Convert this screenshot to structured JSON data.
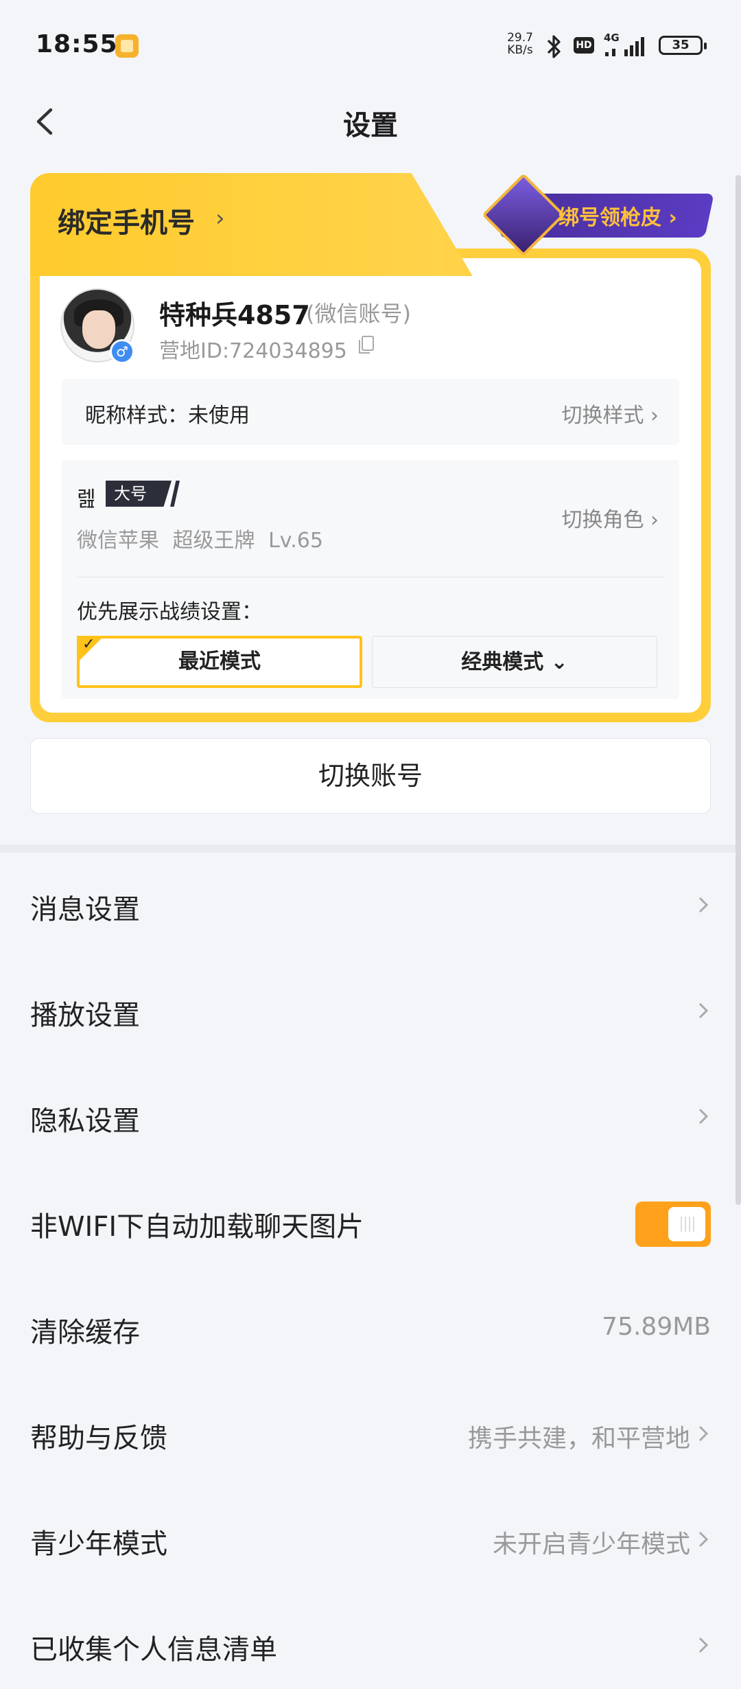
{
  "status_bar": {
    "time": "18:55",
    "net_speed_value": "29.7",
    "net_speed_unit": "KB/s",
    "hd_label": "HD",
    "signal_label": "4G",
    "battery": "35"
  },
  "header": {
    "title": "设置",
    "back_icon": "chevron-left-icon"
  },
  "account_card": {
    "bind_phone_label": "绑定手机号",
    "bind_phone_arrow": "›",
    "promo_label": "绑号领枪皮 ›",
    "user_name": "特种兵4857",
    "account_type": "(微信账号)",
    "camp_id": "营地ID:724034895",
    "nickname_style_label": "昵称样式：未使用",
    "nickname_style_action": "切换样式 ›",
    "role": {
      "name": "렖",
      "tag": "大号",
      "meta": "微信苹果 超级王牌 Lv.65",
      "action": "切换角色 ›"
    },
    "record_pref_label": "优先展示战绩设置：",
    "mode_recent": "最近模式",
    "mode_classic": "经典模式 ⌄",
    "mode_check": "✓"
  },
  "switch_account_label": "切换账号",
  "settings_list": [
    {
      "label": "消息设置",
      "value": ""
    },
    {
      "label": "播放设置",
      "value": ""
    },
    {
      "label": "隐私设置",
      "value": ""
    },
    {
      "label": "非WIFI下自动加载聊天图片",
      "value": ""
    },
    {
      "label": "清除缓存",
      "value": "75.89MB"
    },
    {
      "label": "帮助与反馈",
      "value": "携手共建，和平营地"
    },
    {
      "label": "青少年模式",
      "value": "未开启青少年模式"
    },
    {
      "label": "已收集个人信息清单",
      "value": ""
    }
  ],
  "toggle_state": "on",
  "colors": {
    "accent_yellow": "#ffcf3b",
    "toggle_orange": "#ffa11a",
    "promo_purple": "#4a2e9a"
  }
}
